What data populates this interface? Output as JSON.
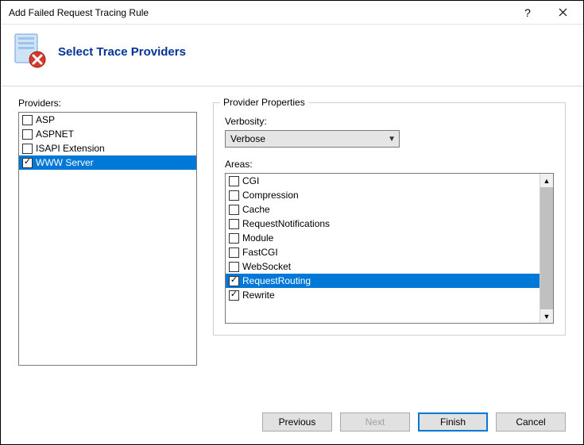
{
  "window": {
    "title": "Add Failed Request Tracing Rule"
  },
  "header": {
    "heading": "Select Trace Providers"
  },
  "providers": {
    "label": "Providers:",
    "items": [
      {
        "label": "ASP",
        "checked": false,
        "selected": false
      },
      {
        "label": "ASPNET",
        "checked": false,
        "selected": false
      },
      {
        "label": "ISAPI Extension",
        "checked": false,
        "selected": false
      },
      {
        "label": "WWW Server",
        "checked": true,
        "selected": true
      }
    ]
  },
  "properties": {
    "group_label": "Provider Properties",
    "verbosity_label": "Verbosity:",
    "verbosity_value": "Verbose",
    "areas_label": "Areas:",
    "areas": [
      {
        "label": "CGI",
        "checked": false,
        "selected": false
      },
      {
        "label": "Compression",
        "checked": false,
        "selected": false
      },
      {
        "label": "Cache",
        "checked": false,
        "selected": false
      },
      {
        "label": "RequestNotifications",
        "checked": false,
        "selected": false
      },
      {
        "label": "Module",
        "checked": false,
        "selected": false
      },
      {
        "label": "FastCGI",
        "checked": false,
        "selected": false
      },
      {
        "label": "WebSocket",
        "checked": false,
        "selected": false
      },
      {
        "label": "RequestRouting",
        "checked": true,
        "selected": true
      },
      {
        "label": "Rewrite",
        "checked": true,
        "selected": false
      }
    ]
  },
  "buttons": {
    "previous": "Previous",
    "next": "Next",
    "finish": "Finish",
    "cancel": "Cancel"
  }
}
